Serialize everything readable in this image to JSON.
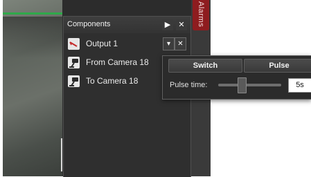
{
  "components_panel": {
    "title": "Components",
    "items": [
      {
        "label": "Output 1",
        "icon": "output-icon"
      },
      {
        "label": "From Camera 18",
        "icon": "camera-icon"
      },
      {
        "label": "To Camera 18",
        "icon": "camera-icon"
      }
    ]
  },
  "alarms_tab": {
    "label": "Alarms"
  },
  "output_popup": {
    "switch_label": "Switch",
    "pulse_label": "Pulse",
    "pulse_time_label": "Pulse time:",
    "pulse_time_value": "5s"
  },
  "colors": {
    "panel_bg": "#2c2c2c",
    "alarms_tab": "#8e1c1f",
    "video_stripe": "#2fa94a"
  }
}
